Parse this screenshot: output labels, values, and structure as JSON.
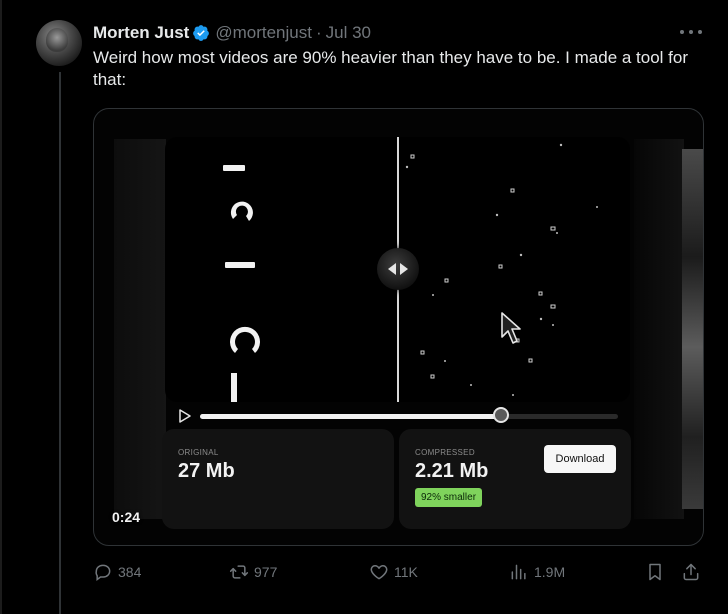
{
  "tweet": {
    "author": {
      "display_name": "Morten Just",
      "handle": "@mortenjust",
      "verified": true,
      "verified_color": "#1d9bf0"
    },
    "separator": "·",
    "date": "Jul 30",
    "text": "Weird how most videos are 90% heavier than they have to be. I made a tool for that:",
    "media": {
      "type": "video",
      "timestamp": "0:24",
      "scrub_progress": 0.72,
      "play_icon": "play-icon",
      "original": {
        "label": "ORIGINAL",
        "value": "27 Mb"
      },
      "compressed": {
        "label": "COMPRESSED",
        "value": "2.21 Mb",
        "badge": "92% smaller",
        "badge_color": "#7fd35c"
      },
      "download_label": "Download"
    },
    "actions": {
      "reply": {
        "icon": "reply-icon",
        "count": "384"
      },
      "retweet": {
        "icon": "retweet-icon",
        "count": "977"
      },
      "like": {
        "icon": "heart-icon",
        "count": "11K"
      },
      "views": {
        "icon": "views-icon",
        "count": "1.9M"
      },
      "bookmark": {
        "icon": "bookmark-icon"
      },
      "share": {
        "icon": "share-icon"
      }
    }
  }
}
